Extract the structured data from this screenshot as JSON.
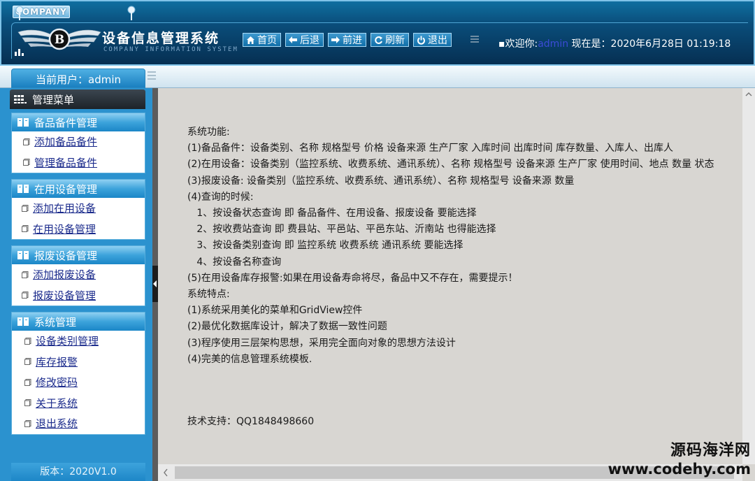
{
  "header": {
    "company_tag": "COMPANY",
    "title": "设备信息管理系统",
    "subtitle": "COMPANY INFORMATION SYSTEM",
    "nav": [
      {
        "label": "首页",
        "icon": "home-icon"
      },
      {
        "label": "后退",
        "icon": "arrow-left-icon"
      },
      {
        "label": "前进",
        "icon": "arrow-right-icon"
      },
      {
        "label": "刷新",
        "icon": "refresh-icon"
      },
      {
        "label": "退出",
        "icon": "power-icon"
      }
    ],
    "welcome_prefix": "▪欢迎你:",
    "welcome_user": "admin",
    "time_prefix": " 现在是：",
    "time": "2020年6月28日 01:19:18"
  },
  "subbar": {
    "current_user": "当前用户：admin"
  },
  "sidebar": {
    "menu_title": "管理菜单",
    "groups": [
      {
        "title": "备品备件管理",
        "items": [
          "添加备品备件",
          "管理备品备件"
        ]
      },
      {
        "title": "在用设备管理",
        "items": [
          "添加在用设备",
          "在用设备管理"
        ]
      },
      {
        "title": "报废设备管理",
        "items": [
          "添加报废设备",
          "报废设备管理"
        ]
      },
      {
        "title": "系统管理",
        "items": [
          "设备类别管理",
          "库存报警",
          "修改密码",
          "关于系统",
          "退出系统"
        ]
      }
    ],
    "version": "版本：2020V1.0"
  },
  "content": {
    "lines": [
      "系统功能:",
      " (1)备品备件：设备类别、名称 规格型号 价格 设备来源 生产厂家 入库时间 出库时间 库存数量、入库人、出库人",
      " (2)在用设备：设备类别（监控系统、收费系统、通讯系统）、名称 规格型号 设备来源 生产厂家 使用时间、地点 数量 状态",
      " (3)报废设备: 设备类别（监控系统、收费系统、通讯系统）、名称 规格型号 设备来源 数量",
      " (4)查询的时候:",
      "   1、按设备状态查询 即 备品备件、在用设备、报废设备 要能选择",
      "   2、按收费站查询 即 费县站、平邑站、平邑东站、沂南站 也得能选择",
      "   3、按设备类别查询 即 监控系统 收费系统 通讯系统 要能选择",
      "   4、按设备名称查询",
      " (5)在用设备库存报警:如果在用设备寿命将尽，备品中又不存在，需要提示！",
      "系统特点:",
      " (1)系统采用美化的菜单和GridView控件",
      " (2)最优化数据库设计，解决了数据一致性问题",
      " (3)程序使用三层架构思想，采用完全面向对象的思想方法设计",
      " (4)完美的信息管理系统模板."
    ],
    "support": "技术支持：QQ1848498660"
  },
  "watermark": {
    "name": "源码海洋网",
    "url": "www.codehy.com"
  },
  "colors": {
    "header_dark": "#062f52",
    "accent": "#2b92cf",
    "link": "#1b2b8c",
    "content_bg": "#d8d6d2"
  }
}
